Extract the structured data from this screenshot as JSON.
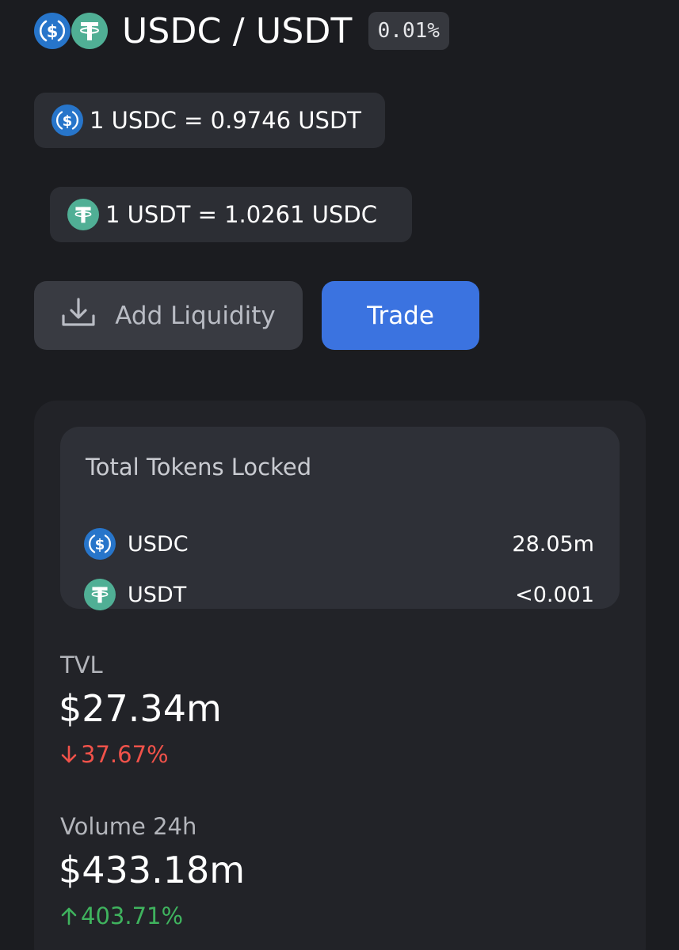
{
  "header": {
    "base_token_icon": "usdc-icon",
    "quote_token_icon": "usdt-icon",
    "pair_title": "USDC / USDT",
    "fee_tier": "0.01%"
  },
  "rates": [
    {
      "icon": "usdc-icon",
      "text": "1 USDC = 0.9746 USDT"
    },
    {
      "icon": "usdt-icon",
      "text": "1 USDT = 1.0261 USDC"
    }
  ],
  "actions": {
    "add_liquidity_label": "Add Liquidity",
    "add_liquidity_icon": "download-icon",
    "trade_label": "Trade"
  },
  "tokens_locked": {
    "title": "Total Tokens Locked",
    "rows": [
      {
        "symbol": "USDC",
        "icon": "usdc-icon",
        "amount": "28.05m"
      },
      {
        "symbol": "USDT",
        "icon": "usdt-icon",
        "amount": "<0.001"
      }
    ]
  },
  "stats": {
    "tvl": {
      "label": "TVL",
      "value": "$27.34m",
      "change": "37.67%",
      "direction": "down"
    },
    "volume": {
      "label": "Volume 24h",
      "value": "$433.18m",
      "change": "403.71%",
      "direction": "up"
    }
  },
  "colors": {
    "background": "#1b1c20",
    "usdc_blue": "#2775ca",
    "usdt_green": "#50af95",
    "trade_button": "#3b73e0",
    "negative": "#f0524a",
    "positive": "#3fb35e"
  }
}
